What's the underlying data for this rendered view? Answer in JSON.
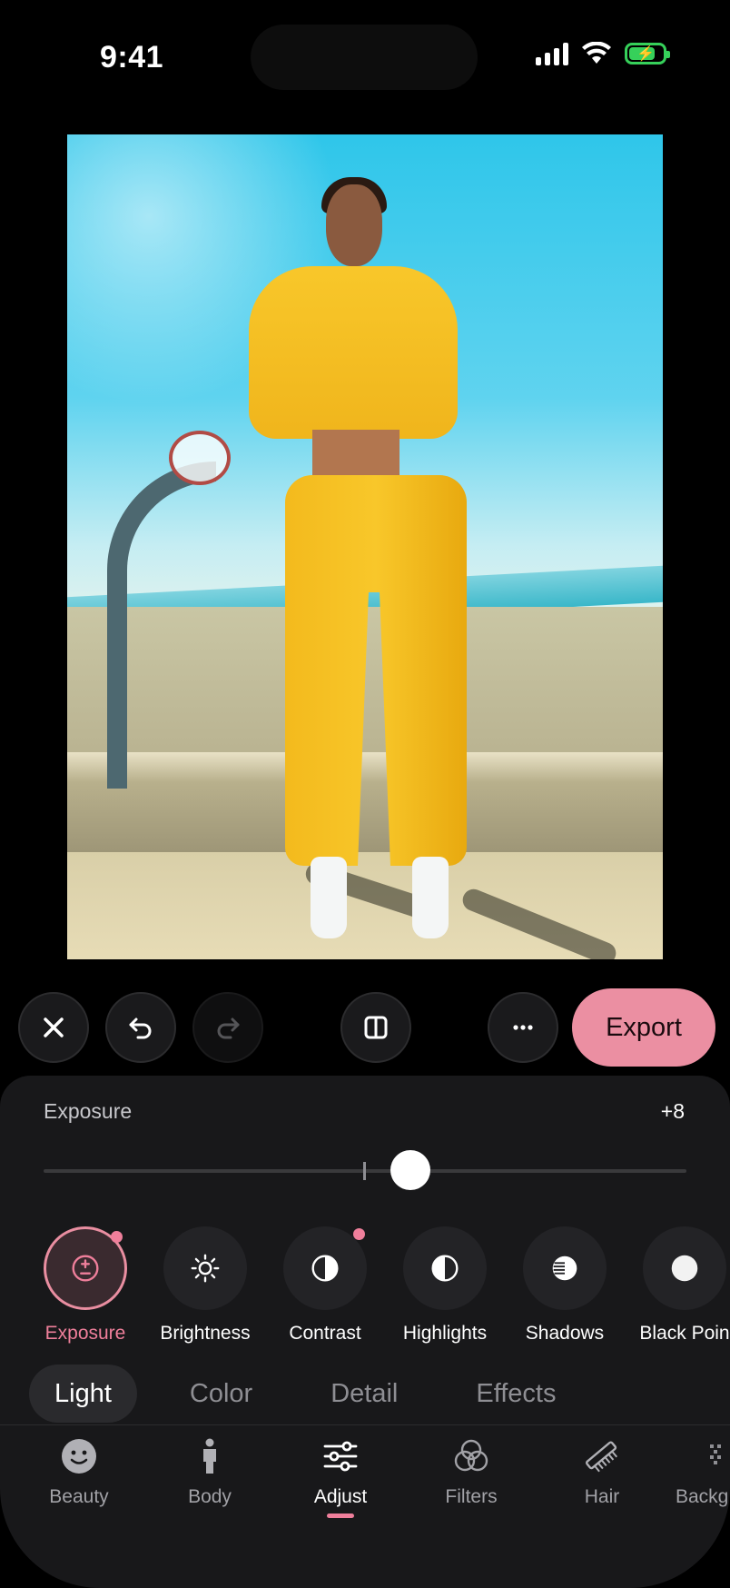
{
  "status_bar": {
    "time": "9:41"
  },
  "photo": {
    "description_icon": "photo-canvas"
  },
  "toolbar": {
    "close_icon": "close-icon",
    "undo_icon": "undo-icon",
    "redo_icon": "redo-icon",
    "compare_icon": "compare-split-icon",
    "more_icon": "more-icon",
    "export_label": "Export"
  },
  "adjustment": {
    "label": "Exposure",
    "value": "+8",
    "slider_value": 8,
    "slider_min": -100,
    "slider_max": 100
  },
  "tools": [
    {
      "label": "Exposure",
      "icon": "exposure-icon",
      "active": true,
      "modified": true
    },
    {
      "label": "Brightness",
      "icon": "brightness-icon",
      "active": false,
      "modified": false
    },
    {
      "label": "Contrast",
      "icon": "contrast-icon",
      "active": false,
      "modified": true
    },
    {
      "label": "Highlights",
      "icon": "highlights-icon",
      "active": false,
      "modified": false
    },
    {
      "label": "Shadows",
      "icon": "shadows-icon",
      "active": false,
      "modified": false
    },
    {
      "label": "Black Poin",
      "icon": "black-point-icon",
      "active": false,
      "modified": false
    }
  ],
  "categories": [
    {
      "label": "Light",
      "active": true
    },
    {
      "label": "Color",
      "active": false
    },
    {
      "label": "Detail",
      "active": false
    },
    {
      "label": "Effects",
      "active": false
    }
  ],
  "nav": [
    {
      "label": "Beauty",
      "icon": "beauty-icon",
      "active": false
    },
    {
      "label": "Body",
      "icon": "body-icon",
      "active": false
    },
    {
      "label": "Adjust",
      "icon": "adjust-icon",
      "active": true
    },
    {
      "label": "Filters",
      "icon": "filters-icon",
      "active": false
    },
    {
      "label": "Hair",
      "icon": "hair-icon",
      "active": false
    },
    {
      "label": "Backg",
      "icon": "background-icon",
      "active": false
    }
  ],
  "colors": {
    "accent": "#eb8fa2",
    "panel": "#18181a",
    "battery": "#36d05a"
  }
}
